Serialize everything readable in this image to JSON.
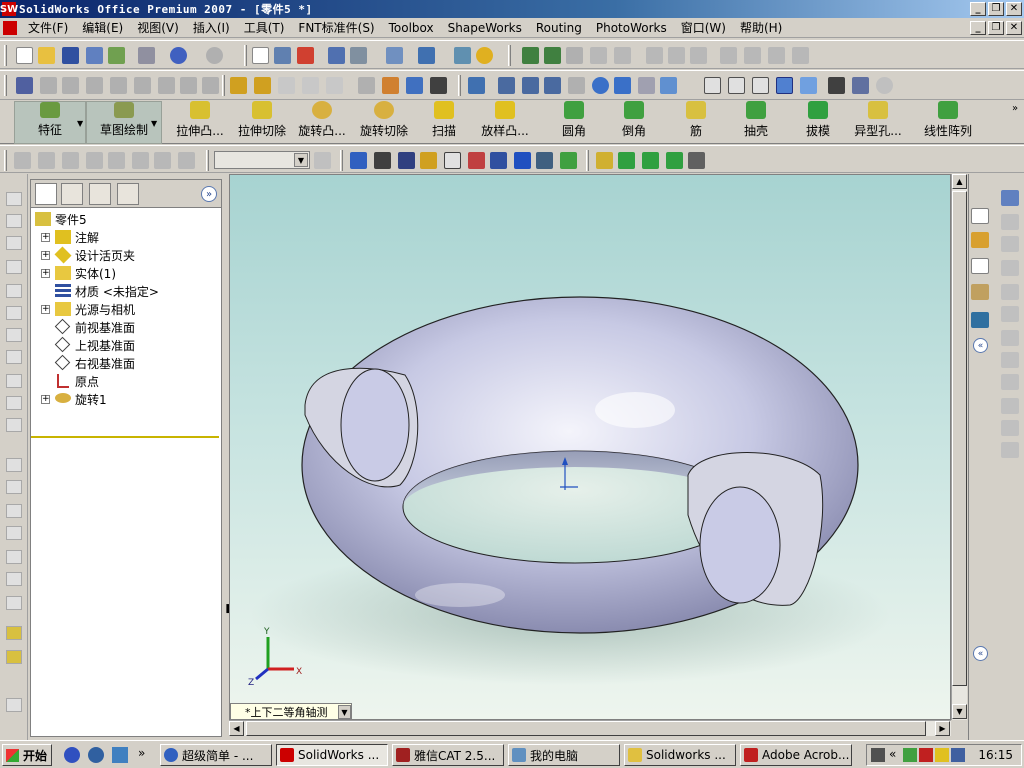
{
  "window": {
    "title": "SolidWorks Office Premium 2007 - [零件5 *]",
    "app_icon": "SW"
  },
  "menu": [
    "文件(F)",
    "编辑(E)",
    "视图(V)",
    "插入(I)",
    "工具(T)",
    "FNT标准件(S)",
    "Toolbox",
    "ShapeWorks",
    "Routing",
    "PhotoWorks",
    "窗口(W)",
    "帮助(H)"
  ],
  "window_buttons": {
    "minimize": "_",
    "restore": "❐",
    "close": "✕"
  },
  "feature_commands": [
    {
      "label": "特征",
      "icon": "features-icon"
    },
    {
      "label": "草图绘制",
      "icon": "sketch-icon"
    },
    {
      "label": "拉伸凸...",
      "icon": "extruded-boss-icon"
    },
    {
      "label": "拉伸切除",
      "icon": "extruded-cut-icon"
    },
    {
      "label": "旋转凸...",
      "icon": "revolved-boss-icon"
    },
    {
      "label": "旋转切除",
      "icon": "revolved-cut-icon"
    },
    {
      "label": "扫描",
      "icon": "sweep-icon"
    },
    {
      "label": "放样凸...",
      "icon": "loft-icon"
    },
    {
      "label": "圆角",
      "icon": "fillet-icon"
    },
    {
      "label": "倒角",
      "icon": "chamfer-icon"
    },
    {
      "label": "筋",
      "icon": "rib-icon"
    },
    {
      "label": "抽壳",
      "icon": "shell-icon"
    },
    {
      "label": "拔模",
      "icon": "draft-icon"
    },
    {
      "label": "异型孔...",
      "icon": "hole-wizard-icon"
    },
    {
      "label": "线性阵列",
      "icon": "linear-pattern-icon"
    }
  ],
  "feature_tree": {
    "root": "零件5",
    "items": [
      {
        "label": "注解",
        "icon": "annotations-icon",
        "expandable": true
      },
      {
        "label": "设计活页夹",
        "icon": "design-binder-icon",
        "expandable": true
      },
      {
        "label": "实体(1)",
        "icon": "solid-bodies-icon",
        "expandable": true
      },
      {
        "label": "材质 <未指定>",
        "icon": "material-icon",
        "expandable": false
      },
      {
        "label": "光源与相机",
        "icon": "lights-cameras-icon",
        "expandable": true
      },
      {
        "label": "前视基准面",
        "icon": "plane-icon",
        "expandable": false
      },
      {
        "label": "上视基准面",
        "icon": "plane-icon",
        "expandable": false
      },
      {
        "label": "右视基准面",
        "icon": "plane-icon",
        "expandable": false
      },
      {
        "label": "原点",
        "icon": "origin-icon",
        "expandable": false
      },
      {
        "label": "旋转1",
        "icon": "revolve-feature-icon",
        "expandable": true
      }
    ]
  },
  "viewport": {
    "view_orientation": "*上下二等角轴测",
    "axis_labels": {
      "x": "X",
      "y": "Y",
      "z": "Z"
    },
    "model": "torus-part",
    "colors": {
      "bg_top": "#a7d3d1",
      "bg_bottom": "#eef5ee",
      "model": "#c9cbe6",
      "section": "#d8d8e0"
    }
  },
  "taskbar": {
    "start": "开始",
    "tasks": [
      {
        "label": "超级简单 - ...",
        "icon": "chat-icon"
      },
      {
        "label": "SolidWorks ...",
        "icon": "solidworks-icon",
        "active": true
      },
      {
        "label": "雅信CAT 2.5...",
        "icon": "translator-icon"
      },
      {
        "label": "我的电脑",
        "icon": "computer-icon"
      },
      {
        "label": "Solidworks ...",
        "icon": "folder-icon"
      },
      {
        "label": "Adobe Acrob...",
        "icon": "acrobat-icon"
      }
    ],
    "clock": "16:15"
  }
}
